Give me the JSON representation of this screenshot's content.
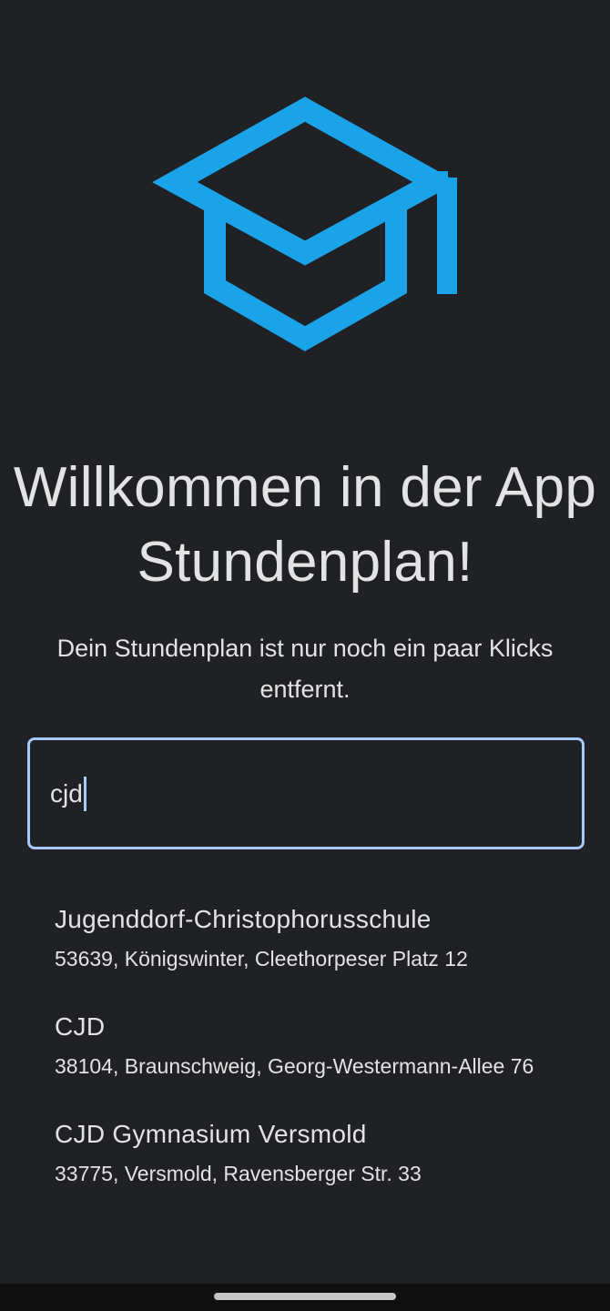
{
  "app": {
    "logo_icon": "graduation-cap-icon",
    "accent_color": "#1aa3e8"
  },
  "welcome": {
    "title": "Willkommen in der App Stundenplan!",
    "subtitle": "Dein Stundenplan ist nur noch ein paar Klicks entfernt."
  },
  "search": {
    "value": "cjd",
    "border_color": "#a8c7fa"
  },
  "results": [
    {
      "name": "Jugenddorf-Christophorusschule",
      "address": "53639, Königswinter, Cleethorpeser Platz 12"
    },
    {
      "name": "CJD",
      "address": "38104, Braunschweig, Georg-Westermann-Allee 76"
    },
    {
      "name": "CJD Gymnasium Versmold",
      "address": "33775, Versmold, Ravensberger Str. 33"
    }
  ]
}
